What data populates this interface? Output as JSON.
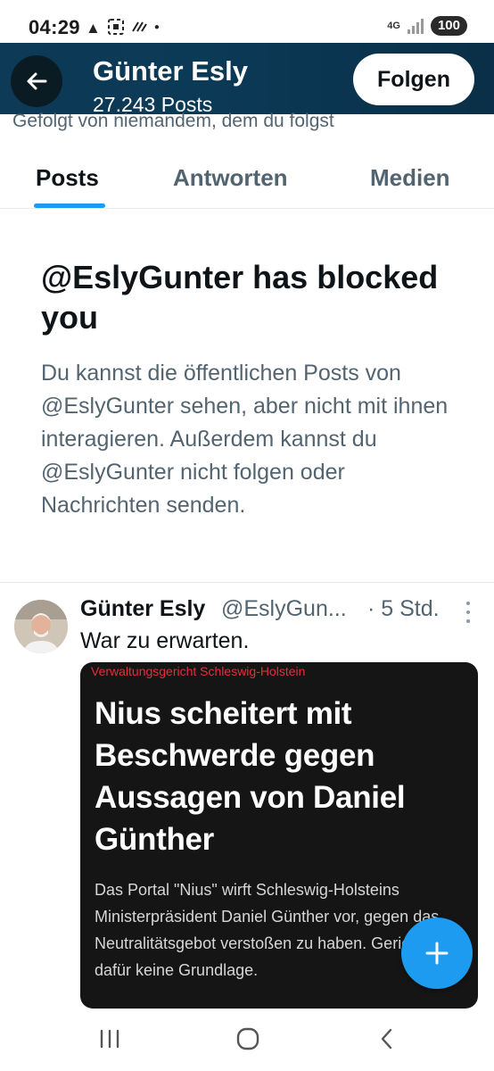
{
  "status_bar": {
    "time": "04:29",
    "network": "4G",
    "battery": "100"
  },
  "header": {
    "name": "Günter Esly",
    "posts_count": "27.243 Posts",
    "follow_label": "Folgen",
    "banner_color": "#0b3a57"
  },
  "profile": {
    "followed_by": "Gefolgt von niemandem, dem du folgst"
  },
  "tabs": [
    {
      "label": "Posts",
      "active": true
    },
    {
      "label": "Antworten",
      "active": false
    },
    {
      "label": "Medien",
      "active": false
    }
  ],
  "blocked": {
    "title": "@EslyGunter has blocked you",
    "body": "Du kannst die öffentlichen Posts von @EslyGunter sehen, aber nicht mit ihnen interagieren. Außerdem kannst du @EslyGunter nicht folgen oder Nachrichten senden."
  },
  "tweet": {
    "name": "Günter Esly",
    "handle": "@EslyGun...",
    "time": "· 5 Std.",
    "text": "War zu erwarten.",
    "media": {
      "kicker": "Verwaltungsgericht Schleswig-Holstein",
      "headline": "Nius scheitert mit Beschwerde gegen Aussagen von Daniel Günther",
      "teaser": "Das Portal \"Nius\" wirft Schleswig-Holsteins Ministerpräsident Daniel Günther vor, gegen das Neutralitätsgebot verstoßen zu haben. Gericht sieht dafür keine Grundlage."
    }
  },
  "colors": {
    "accent": "#1d9bf0",
    "secondary_text": "#536471",
    "kicker_red": "#e0303a"
  },
  "icons": {
    "back": "arrow-left-icon",
    "compose": "plus-icon",
    "more": "more-vertical-icon",
    "nav_recents": "recents-icon",
    "nav_home": "home-circle-icon",
    "nav_back": "chevron-left-icon"
  }
}
